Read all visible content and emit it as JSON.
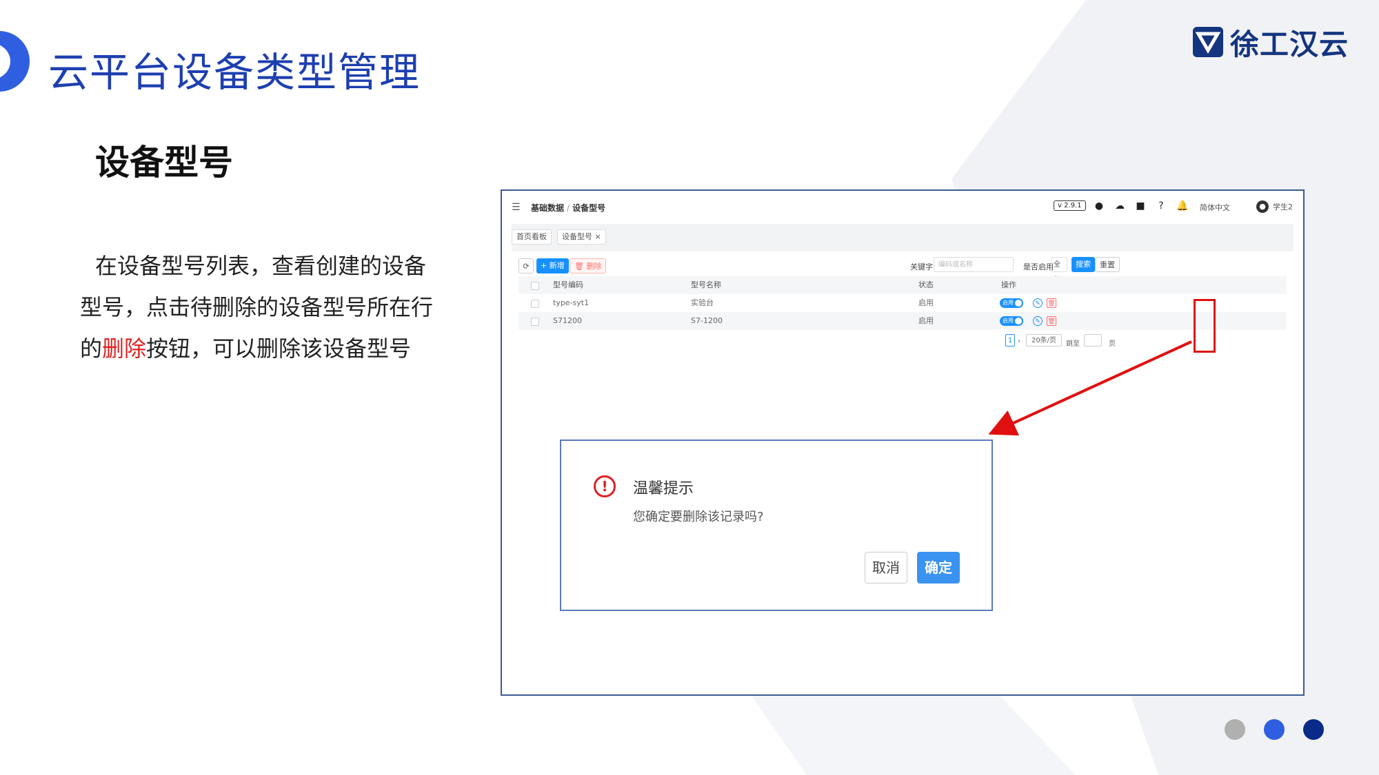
{
  "slide": {
    "title": "云平台设备类型管理",
    "logo_text": "徐工汉云",
    "section_title": "设备型号",
    "desc_part1": "在设备型号列表，查看创建的设备型号，点击待删除的设备型号所在行的",
    "desc_highlight": "删除",
    "desc_part2": "按钮，可以删除该设备型号",
    "colors": {
      "title": "#1d3fb0",
      "accent_blue": "#2f5fe0",
      "navy": "#14357f",
      "highlight": "#e02020"
    },
    "dots": [
      {
        "color": "#b0b0b0"
      },
      {
        "color": "#2f5fe0"
      },
      {
        "color": "#0a2a8a"
      }
    ]
  },
  "app": {
    "topbar": {
      "breadcrumb_parent": "基础数据",
      "breadcrumb_sep": "/",
      "breadcrumb_current": "设备型号",
      "version": "v 2.9.1",
      "language": "简体中文",
      "user": "学生2",
      "icons": [
        "github-icon",
        "cloud-icon",
        "fullscreen-icon",
        "help-icon",
        "bell-icon"
      ]
    },
    "tabs": [
      {
        "label": "首页看板"
      },
      {
        "label": "设备型号 ×"
      }
    ],
    "toolbar": {
      "refresh_icon": "⟳",
      "add_label": "+ 新增",
      "delete_label": "🗑 删除",
      "keyword_label": "关键字",
      "keyword_placeholder": "编码或名称",
      "enabled_label": "是否启用",
      "enabled_value": "全部",
      "search_label": "搜索",
      "reset_label": "重置"
    },
    "table": {
      "columns": [
        "型号编码",
        "型号名称",
        "状态",
        "操作"
      ],
      "rows": [
        {
          "code": "type-syt1",
          "name": "实验台",
          "status": "启用",
          "toggle": "启用"
        },
        {
          "code": "S71200",
          "name": "S7-1200",
          "status": "启用",
          "toggle": "启用"
        }
      ]
    },
    "pagination": {
      "page": "1",
      "page_size": "20条/页",
      "goto_label": "跳至",
      "page_unit": "页"
    }
  },
  "dialog": {
    "title": "温馨提示",
    "message": "您确定要删除该记录吗?",
    "cancel_label": "取消",
    "ok_label": "确定"
  }
}
